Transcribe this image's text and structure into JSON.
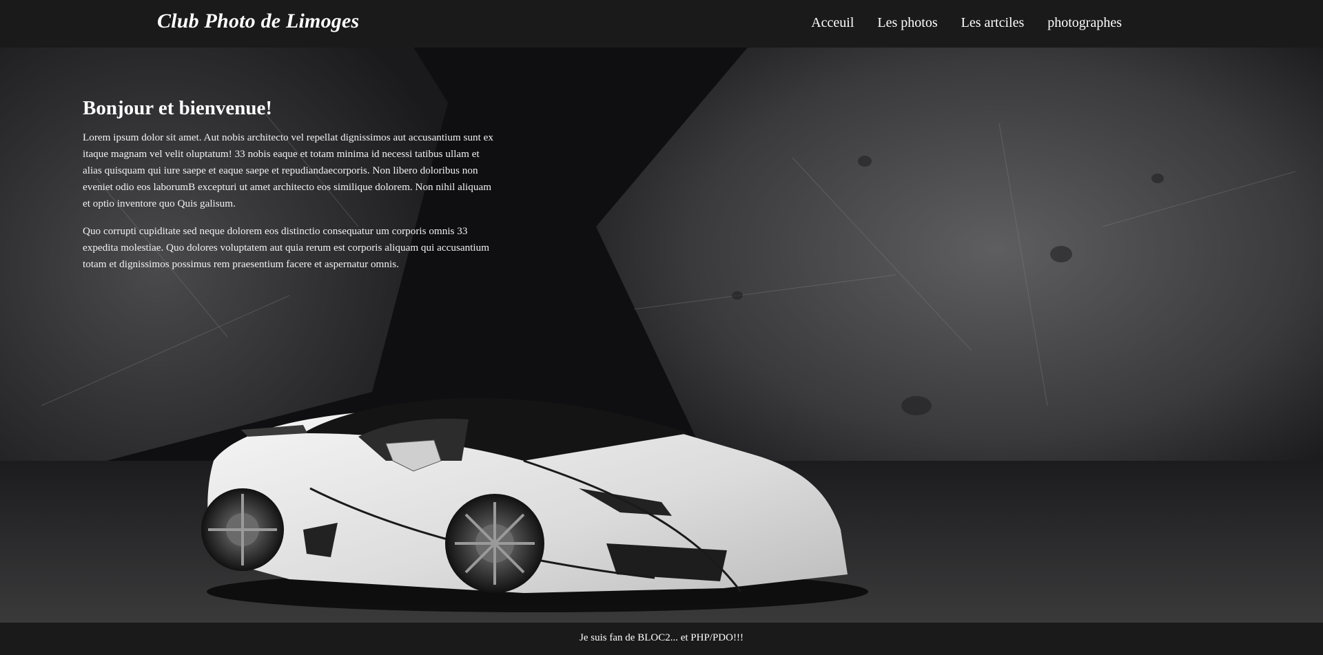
{
  "header": {
    "site_title": "Club Photo de Limoges",
    "nav": [
      {
        "label": "Acceuil"
      },
      {
        "label": "Les photos"
      },
      {
        "label": "Les artciles"
      },
      {
        "label": "photographes"
      }
    ]
  },
  "main": {
    "heading": "Bonjour et bienvenue!",
    "paragraphs": [
      "Lorem ipsum dolor sit amet. Aut nobis architecto vel repellat dignissimos aut accusantium sunt ex itaque magnam vel velit oluptatum! 33 nobis eaque et totam minima id necessi tatibus ullam et alias quisquam qui iure saepe et eaque saepe et repudiandaecorporis. Non libero doloribus non eveniet odio eos laborumB excepturi ut amet architecto eos similique dolorem. Non nihil aliquam et optio inventore quo Quis galisum.",
      "Quo corrupti cupiditate sed neque dolorem eos distinctio consequatur um corporis omnis 33 expedita molestiae. Quo dolores voluptatem aut quia rerum est corporis aliquam qui accusantium totam et dignissimos possimus rem praesentium facere et aspernatur omnis."
    ],
    "hero_image": "white-sports-car-photo"
  },
  "footer": {
    "text": "Je suis fan de BLOC2... et PHP/PDO!!!"
  },
  "colors": {
    "header_bg": "#1a1a1a",
    "footer_bg": "#1a1a1a",
    "text": "#ffffff"
  }
}
